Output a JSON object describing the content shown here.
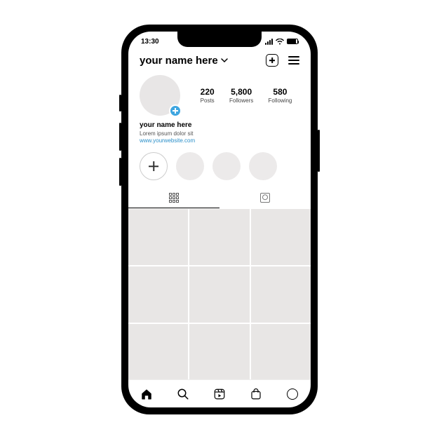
{
  "status": {
    "time": "13:30"
  },
  "header": {
    "username": "your name here"
  },
  "stats": {
    "posts": {
      "count": "220",
      "label": "Posts"
    },
    "followers": {
      "count": "5,800",
      "label": "Followers"
    },
    "following": {
      "count": "580",
      "label": "Following"
    }
  },
  "bio": {
    "name": "your name here",
    "text": "Lorem ipsum dolor sit",
    "link": "www.yourwebsite.com"
  }
}
